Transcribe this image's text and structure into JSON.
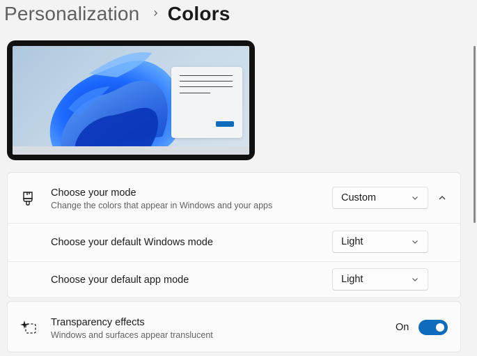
{
  "breadcrumb": {
    "parent": "Personalization",
    "separator": "›",
    "current": "Colors"
  },
  "mode_card": {
    "title": "Choose your mode",
    "subtitle": "Change the colors that appear in Windows and your apps",
    "value": "Custom",
    "icon": "brush-icon",
    "expanded": true
  },
  "windows_mode": {
    "title": "Choose your default Windows mode",
    "value": "Light"
  },
  "app_mode": {
    "title": "Choose your default app mode",
    "value": "Light"
  },
  "transparency": {
    "title": "Transparency effects",
    "subtitle": "Windows and surfaces appear translucent",
    "state_label": "On",
    "on": true,
    "icon": "transparency-sparkle-icon"
  },
  "colors": {
    "accent": "#0f6cbd",
    "background": "#f3f3f3",
    "card": "#fbfbfb"
  }
}
